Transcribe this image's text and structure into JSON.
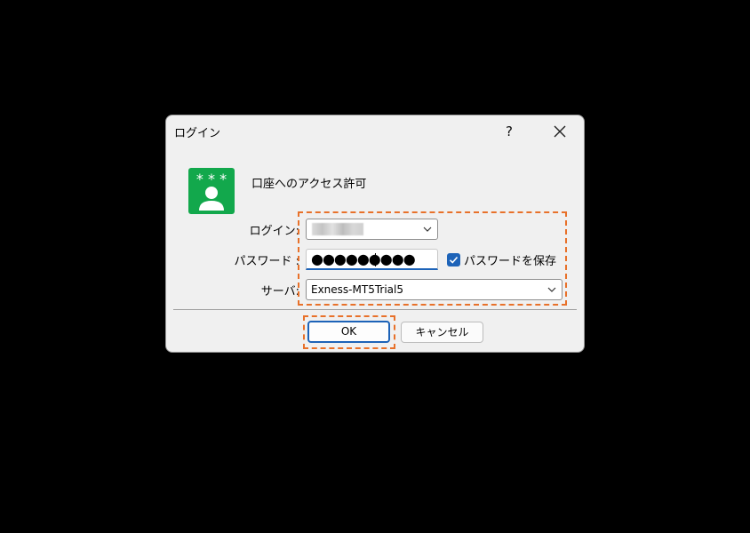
{
  "window": {
    "title": "ログイン",
    "help_label": "?",
    "close_icon": "close-icon"
  },
  "header": {
    "icon": "user-key-icon",
    "text": "口座へのアクセス許可"
  },
  "form": {
    "login_label": "ログイン:",
    "login_value_redacted": true,
    "password_label": "パスワード :",
    "password_masked": "●●●●●●●●●",
    "save_password_checked": true,
    "save_password_label": "パスワードを保存",
    "server_label": "サーバ:",
    "server_value": "Exness-MT5Trial5"
  },
  "buttons": {
    "ok_label": "OK",
    "cancel_label": "キャンセル"
  },
  "colors": {
    "accent": "#1d63b8",
    "icon_green": "#12a84c",
    "highlight": "#e8712a",
    "dialog_bg": "#f0f0f0"
  }
}
